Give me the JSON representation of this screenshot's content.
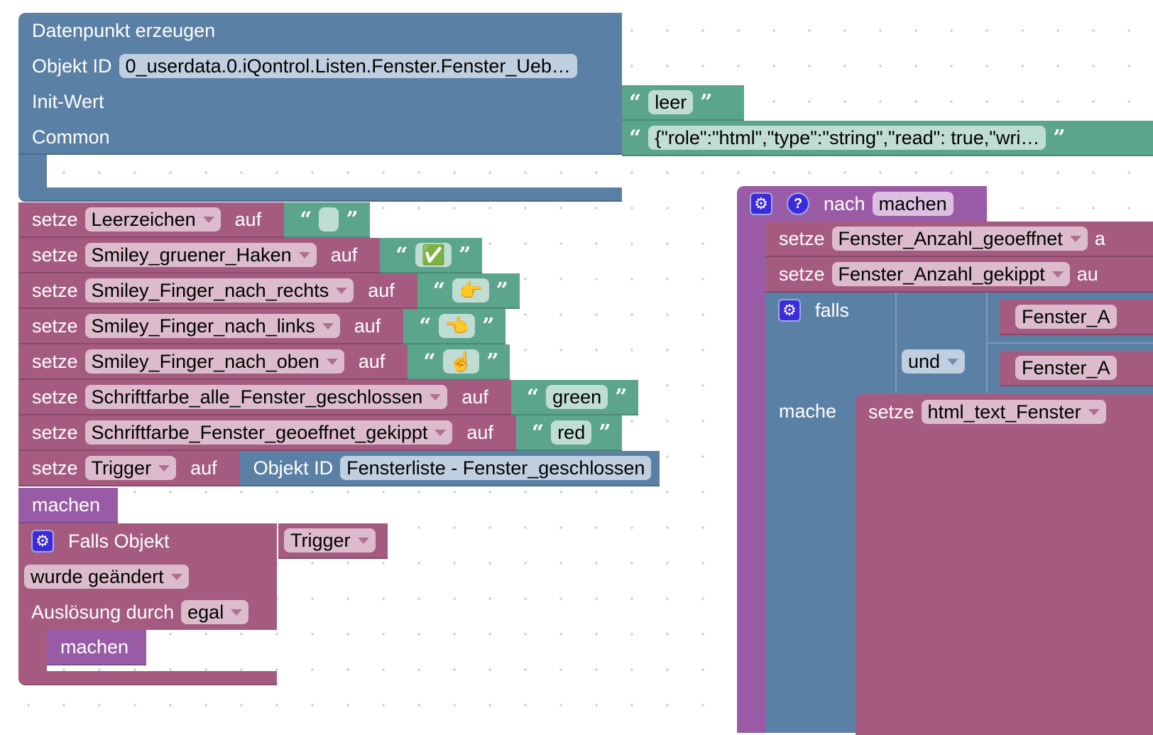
{
  "colors": {
    "logic": "#5b80a5",
    "variables": "#a55b80",
    "text": "#5ba58c",
    "procedures": "#995ba5"
  },
  "create_block": {
    "title": "Datenpunkt erzeugen",
    "object_id_label": "Objekt ID",
    "object_id_value": "0_userdata.0.iQontrol.Listen.Fenster.Fenster_Ueb…",
    "init_label": "Init-Wert",
    "init_value": "leer",
    "common_label": "Common",
    "common_value": "{\"role\":\"html\",\"type\":\"string\",\"read\": true,\"wri…"
  },
  "set_rows": [
    {
      "setze": "setze",
      "var": "Leerzeichen",
      "auf": "auf",
      "value": "",
      "type": "text"
    },
    {
      "setze": "setze",
      "var": "Smiley_gruener_Haken",
      "auf": "auf",
      "value": "✅",
      "type": "text"
    },
    {
      "setze": "setze",
      "var": "Smiley_Finger_nach_rechts",
      "auf": "auf",
      "value": "👉",
      "type": "text"
    },
    {
      "setze": "setze",
      "var": "Smiley_Finger_nach_links",
      "auf": "auf",
      "value": "👈",
      "type": "text"
    },
    {
      "setze": "setze",
      "var": "Smiley_Finger_nach_oben",
      "auf": "auf",
      "value": "☝️",
      "type": "text"
    },
    {
      "setze": "setze",
      "var": "Schriftfarbe_alle_Fenster_geschlossen",
      "auf": "auf",
      "value": "green",
      "type": "text"
    },
    {
      "setze": "setze",
      "var": "Schriftfarbe_Fenster_geoeffnet_gekippt",
      "auf": "auf",
      "value": "red",
      "type": "text"
    },
    {
      "setze": "setze",
      "var": "Trigger",
      "auf": "auf",
      "value": "Fensterliste - Fenster_geschlossen",
      "type": "object",
      "object_label": "Objekt ID"
    }
  ],
  "machen_call": "machen",
  "trigger_block": {
    "label": "Falls Objekt",
    "object": "Trigger",
    "changed": "wurde geändert",
    "trigger_label": "Auslösung durch",
    "trigger_value": "egal",
    "inner": "machen"
  },
  "procedure": {
    "nach": "nach",
    "name": "machen",
    "rows": [
      {
        "setze": "setze",
        "var": "Fenster_Anzahl_geoeffnet",
        "auf": "a"
      },
      {
        "setze": "setze",
        "var": "Fenster_Anzahl_gekippt",
        "auf": "au"
      }
    ],
    "if": {
      "falls": "falls",
      "op": "und",
      "cond1": "Fenster_A",
      "cond2": "Fenster_A",
      "mache": "mache",
      "inner_setze": "setze",
      "inner_var": "html_text_Fenster"
    }
  }
}
